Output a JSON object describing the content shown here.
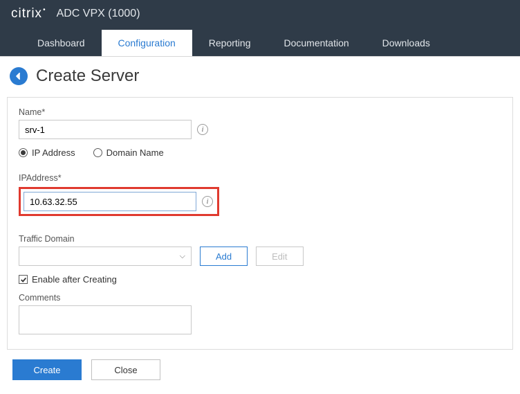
{
  "header": {
    "brand": "citrix",
    "product": "ADC VPX (1000)"
  },
  "tabs": {
    "items": [
      "Dashboard",
      "Configuration",
      "Reporting",
      "Documentation",
      "Downloads"
    ],
    "active_index": 1
  },
  "page": {
    "title": "Create Server"
  },
  "form": {
    "name_label": "Name*",
    "name_value": "srv-1",
    "addr_type": {
      "ip": "IP Address",
      "domain": "Domain Name",
      "selected": "ip"
    },
    "ipaddress_label": "IPAddress*",
    "ipaddress_value": "10.63.32.55",
    "traffic_domain_label": "Traffic Domain",
    "traffic_domain_value": "",
    "add_label": "Add",
    "edit_label": "Edit",
    "enable_after_label": "Enable after Creating",
    "enable_after_checked": true,
    "comments_label": "Comments",
    "comments_value": ""
  },
  "footer": {
    "create": "Create",
    "close": "Close"
  }
}
